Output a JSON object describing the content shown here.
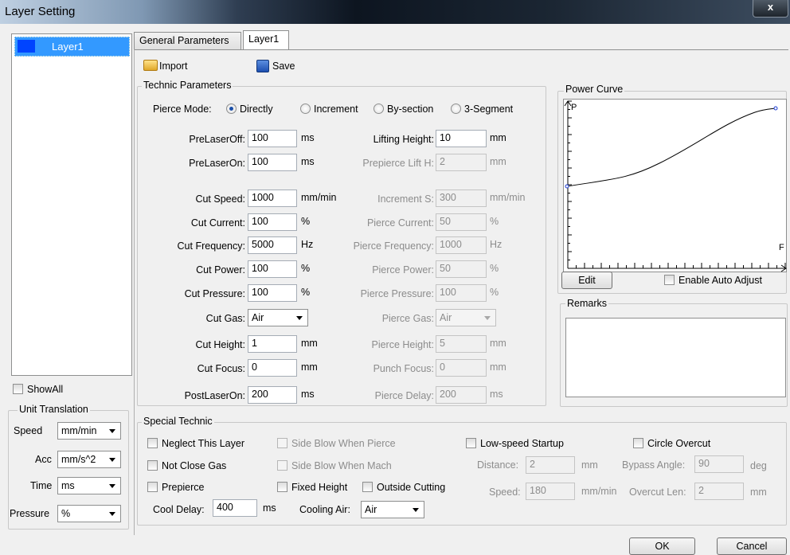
{
  "window": {
    "title": "Layer Setting",
    "close": "x"
  },
  "layers": {
    "items": [
      {
        "name": "Layer1",
        "color": "#0044ff"
      }
    ],
    "show_all": "ShowAll"
  },
  "unit": {
    "title": "Unit Translation",
    "speed_label": "Speed",
    "speed_value": "mm/min",
    "acc_label": "Acc",
    "acc_value": "mm/s^2",
    "time_label": "Time",
    "time_value": "ms",
    "pressure_label": "Pressure",
    "pressure_value": "%"
  },
  "tabs": [
    "General Parameters",
    "Layer1"
  ],
  "toolbar": {
    "import": "Import",
    "save": "Save"
  },
  "technic": {
    "title": "Technic Parameters",
    "pierce_mode_label": "Pierce Mode:",
    "pierce_modes": [
      "Directly",
      "Increment",
      "By-section",
      "3-Segment"
    ],
    "left": [
      {
        "label": "PreLaserOff:",
        "value": "100",
        "unit": "ms"
      },
      {
        "label": "PreLaserOn:",
        "value": "100",
        "unit": "ms"
      },
      {
        "label": "Cut Speed:",
        "value": "1000",
        "unit": "mm/min"
      },
      {
        "label": "Cut Current:",
        "value": "100",
        "unit": "%"
      },
      {
        "label": "Cut Frequency:",
        "value": "5000",
        "unit": "Hz"
      },
      {
        "label": "Cut Power:",
        "value": "100",
        "unit": "%"
      },
      {
        "label": "Cut Pressure:",
        "value": "100",
        "unit": "%"
      },
      {
        "label": "Cut Gas:",
        "value": "Air",
        "unit": ""
      },
      {
        "label": "Cut Height:",
        "value": "1",
        "unit": "mm"
      },
      {
        "label": "Cut Focus:",
        "value": "0",
        "unit": "mm"
      },
      {
        "label": "PostLaserOn:",
        "value": "200",
        "unit": "ms"
      }
    ],
    "right": [
      {
        "label": "Lifting Height:",
        "value": "10",
        "unit": "mm"
      },
      {
        "label": "Prepierce Lift H:",
        "value": "2",
        "unit": "mm"
      },
      {
        "label": "Increment S:",
        "value": "300",
        "unit": "mm/min"
      },
      {
        "label": "Pierce Current:",
        "value": "50",
        "unit": "%"
      },
      {
        "label": "Pierce Frequency:",
        "value": "1000",
        "unit": "Hz"
      },
      {
        "label": "Pierce Power:",
        "value": "50",
        "unit": "%"
      },
      {
        "label": "Pierce Pressure:",
        "value": "100",
        "unit": "%"
      },
      {
        "label": "Pierce Gas:",
        "value": "Air",
        "unit": ""
      },
      {
        "label": "Pierce Height:",
        "value": "5",
        "unit": "mm"
      },
      {
        "label": "Punch Focus:",
        "value": "0",
        "unit": "mm"
      },
      {
        "label": "Pierce Delay:",
        "value": "200",
        "unit": "ms"
      }
    ]
  },
  "power_curve": {
    "title": "Power Curve",
    "y_label": "P",
    "x_label": "F",
    "edit": "Edit",
    "auto_adjust": "Enable Auto Adjust"
  },
  "remarks": {
    "title": "Remarks",
    "value": ""
  },
  "special": {
    "title": "Special Technic",
    "neglect": "Neglect This Layer",
    "side_blow_pierce": "Side Blow When Pierce",
    "not_close_gas": "Not Close Gas",
    "side_blow_mach": "Side Blow When Mach",
    "prepierce": "Prepierce",
    "fixed_height": "Fixed Height",
    "outside_cutting": "Outside Cutting",
    "cool_delay_label": "Cool Delay:",
    "cool_delay_value": "400",
    "cool_delay_unit": "ms",
    "cooling_air_label": "Cooling Air:",
    "cooling_air_value": "Air",
    "low_speed": "Low-speed Startup",
    "distance_label": "Distance:",
    "distance_value": "2",
    "distance_unit": "mm",
    "speed_label": "Speed:",
    "speed_value": "180",
    "speed_unit": "mm/min",
    "circle_overcut": "Circle Overcut",
    "bypass_label": "Bypass Angle:",
    "bypass_value": "90",
    "bypass_unit": "deg",
    "overcut_label": "Overcut Len:",
    "overcut_value": "2",
    "overcut_unit": "mm"
  },
  "buttons": {
    "ok": "OK",
    "cancel": "Cancel"
  }
}
